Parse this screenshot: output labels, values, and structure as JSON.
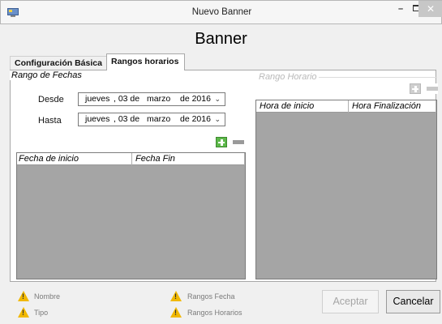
{
  "window": {
    "title": "Nuevo Banner",
    "minimize_glyph": "–",
    "close_glyph": "✕"
  },
  "header": {
    "title": "Banner"
  },
  "tabs": [
    {
      "label": "Configuración Básica"
    },
    {
      "label": "Rangos horarios"
    }
  ],
  "rango_fechas": {
    "legend": "Rango de Fechas",
    "desde_label": "Desde",
    "hasta_label": "Hasta",
    "desde": {
      "weekday": "jueves",
      "day": ", 03 de",
      "month": "marzo",
      "year": "de 2016"
    },
    "hasta": {
      "weekday": "jueves",
      "day": ", 03 de",
      "month": "marzo",
      "year": "de 2016"
    },
    "columns": [
      "Fecha de inicio",
      "Fecha Fin"
    ],
    "rows": []
  },
  "rango_horario": {
    "legend": "Rango Horario",
    "columns": [
      "Hora de inicio",
      "Hora Finalización"
    ],
    "rows": []
  },
  "validation": {
    "nombre": "Nombre",
    "tipo": "Tipo",
    "rangos_fecha": "Rangos Fecha",
    "rangos_horarios": "Rangos Horarios"
  },
  "buttons": {
    "aceptar": "Aceptar",
    "cancelar": "Cancelar"
  },
  "icons": {
    "add": "plus-icon",
    "remove": "minus-icon",
    "warning": "warning-icon",
    "chevron": "chevron-down-icon"
  }
}
